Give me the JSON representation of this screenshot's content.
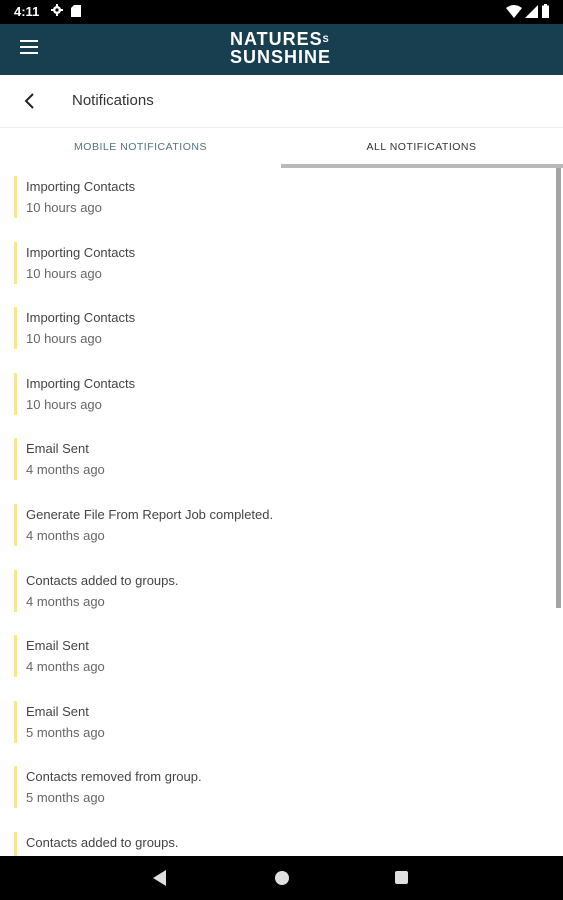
{
  "status_bar": {
    "time": "4:11"
  },
  "app_bar": {
    "brand_line1": "NATURES",
    "brand_mark": "S",
    "brand_line2": "SUNSHINE"
  },
  "header": {
    "title": "Notifications"
  },
  "tabs": [
    {
      "label": "MOBILE NOTIFICATIONS",
      "selected": false
    },
    {
      "label": "ALL NOTIFICATIONS",
      "selected": true
    }
  ],
  "notifications": [
    {
      "title": "Importing Contacts",
      "time": "10 hours ago"
    },
    {
      "title": "Importing Contacts",
      "time": "10 hours ago"
    },
    {
      "title": "Importing Contacts",
      "time": "10 hours ago"
    },
    {
      "title": "Importing Contacts",
      "time": "10 hours ago"
    },
    {
      "title": "Email Sent",
      "time": "4 months ago"
    },
    {
      "title": "Generate File From Report Job completed.",
      "time": "4 months ago"
    },
    {
      "title": "Contacts added to groups.",
      "time": "4 months ago"
    },
    {
      "title": "Email Sent",
      "time": "4 months ago"
    },
    {
      "title": "Email Sent",
      "time": "5 months ago"
    },
    {
      "title": "Contacts removed from group.",
      "time": "5 months ago"
    },
    {
      "title": "Contacts added to groups.",
      "time": ""
    }
  ],
  "colors": {
    "app_bar": "#173f4f",
    "accent_bar": "#f5e68f",
    "tab_inactive": "#4f7380"
  }
}
